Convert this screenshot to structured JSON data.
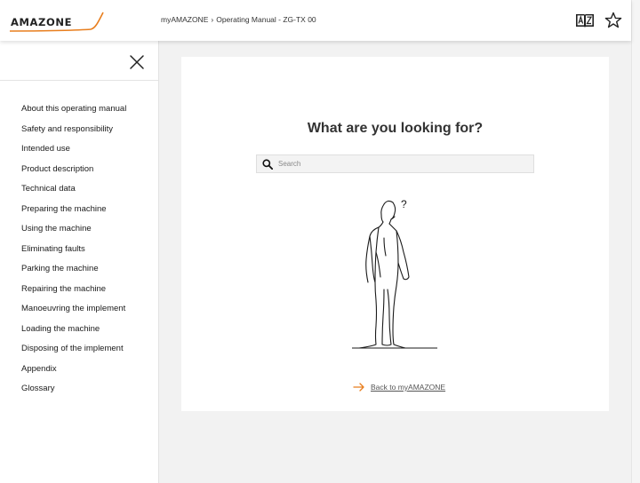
{
  "brand": {
    "logo_text": "AMAZONE",
    "accent": "#e87e1e"
  },
  "header": {
    "breadcrumb": [
      "myAMAZONE",
      "Operating Manual - ZG-TX 00"
    ],
    "breadcrumb_separator": "›",
    "dictionary_icon": "dictionary-book-icon",
    "favorite_icon": "star-icon"
  },
  "sidebar": {
    "close_icon": "close-icon",
    "items": [
      {
        "label": "About this operating manual"
      },
      {
        "label": "Safety and responsibility"
      },
      {
        "label": "Intended use"
      },
      {
        "label": "Product description"
      },
      {
        "label": "Technical data"
      },
      {
        "label": "Preparing the machine"
      },
      {
        "label": "Using the machine"
      },
      {
        "label": "Eliminating faults"
      },
      {
        "label": "Parking the machine"
      },
      {
        "label": "Repairing the machine"
      },
      {
        "label": "Manoeuvring the implement"
      },
      {
        "label": "Loading the machine"
      },
      {
        "label": "Disposing of the implement"
      },
      {
        "label": "Appendix"
      },
      {
        "label": "Glossary"
      }
    ]
  },
  "main": {
    "title": "What are you looking for?",
    "search": {
      "placeholder": "Search",
      "value": ""
    },
    "question_mark": "?",
    "back_link": "Back to myAMAZONE"
  }
}
